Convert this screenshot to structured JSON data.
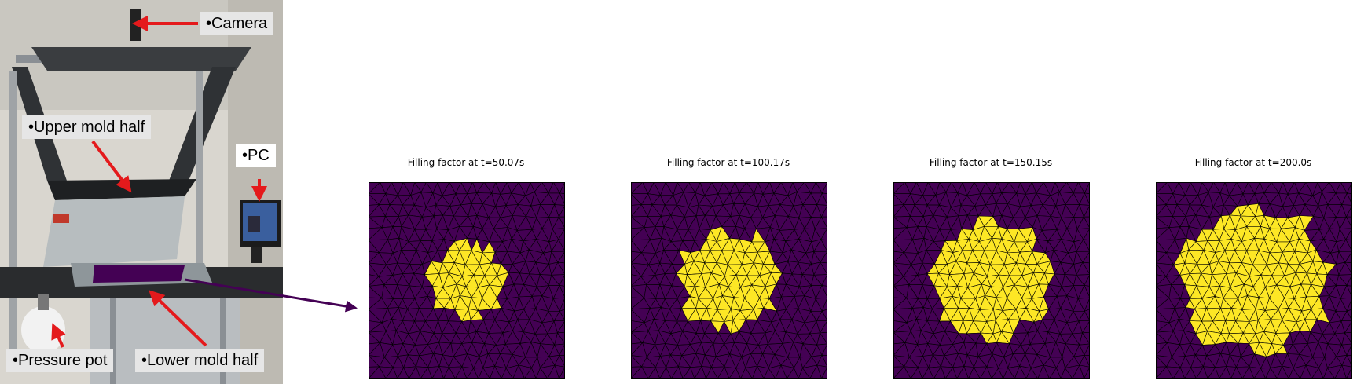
{
  "callouts": {
    "camera": "•Camera",
    "upper_mold": "•Upper mold half",
    "pc": "•PC",
    "pressure_pot": "•Pressure pot",
    "lower_mold": "•Lower mold half"
  },
  "panels": [
    {
      "title": "Filling factor at t=50.07s",
      "filled_radius": 0.19
    },
    {
      "title": "Filling factor at t=100.17s",
      "filled_radius": 0.25
    },
    {
      "title": "Filling factor at t=150.15s",
      "filled_radius": 0.3
    },
    {
      "title": "Filling factor at t=200.0s",
      "filled_radius": 0.37
    }
  ],
  "colors": {
    "empty": "#440154",
    "filled": "#fde725",
    "mesh_line": "#000000",
    "arrow_red": "#e41a1c",
    "arrow_purple": "#440154"
  }
}
